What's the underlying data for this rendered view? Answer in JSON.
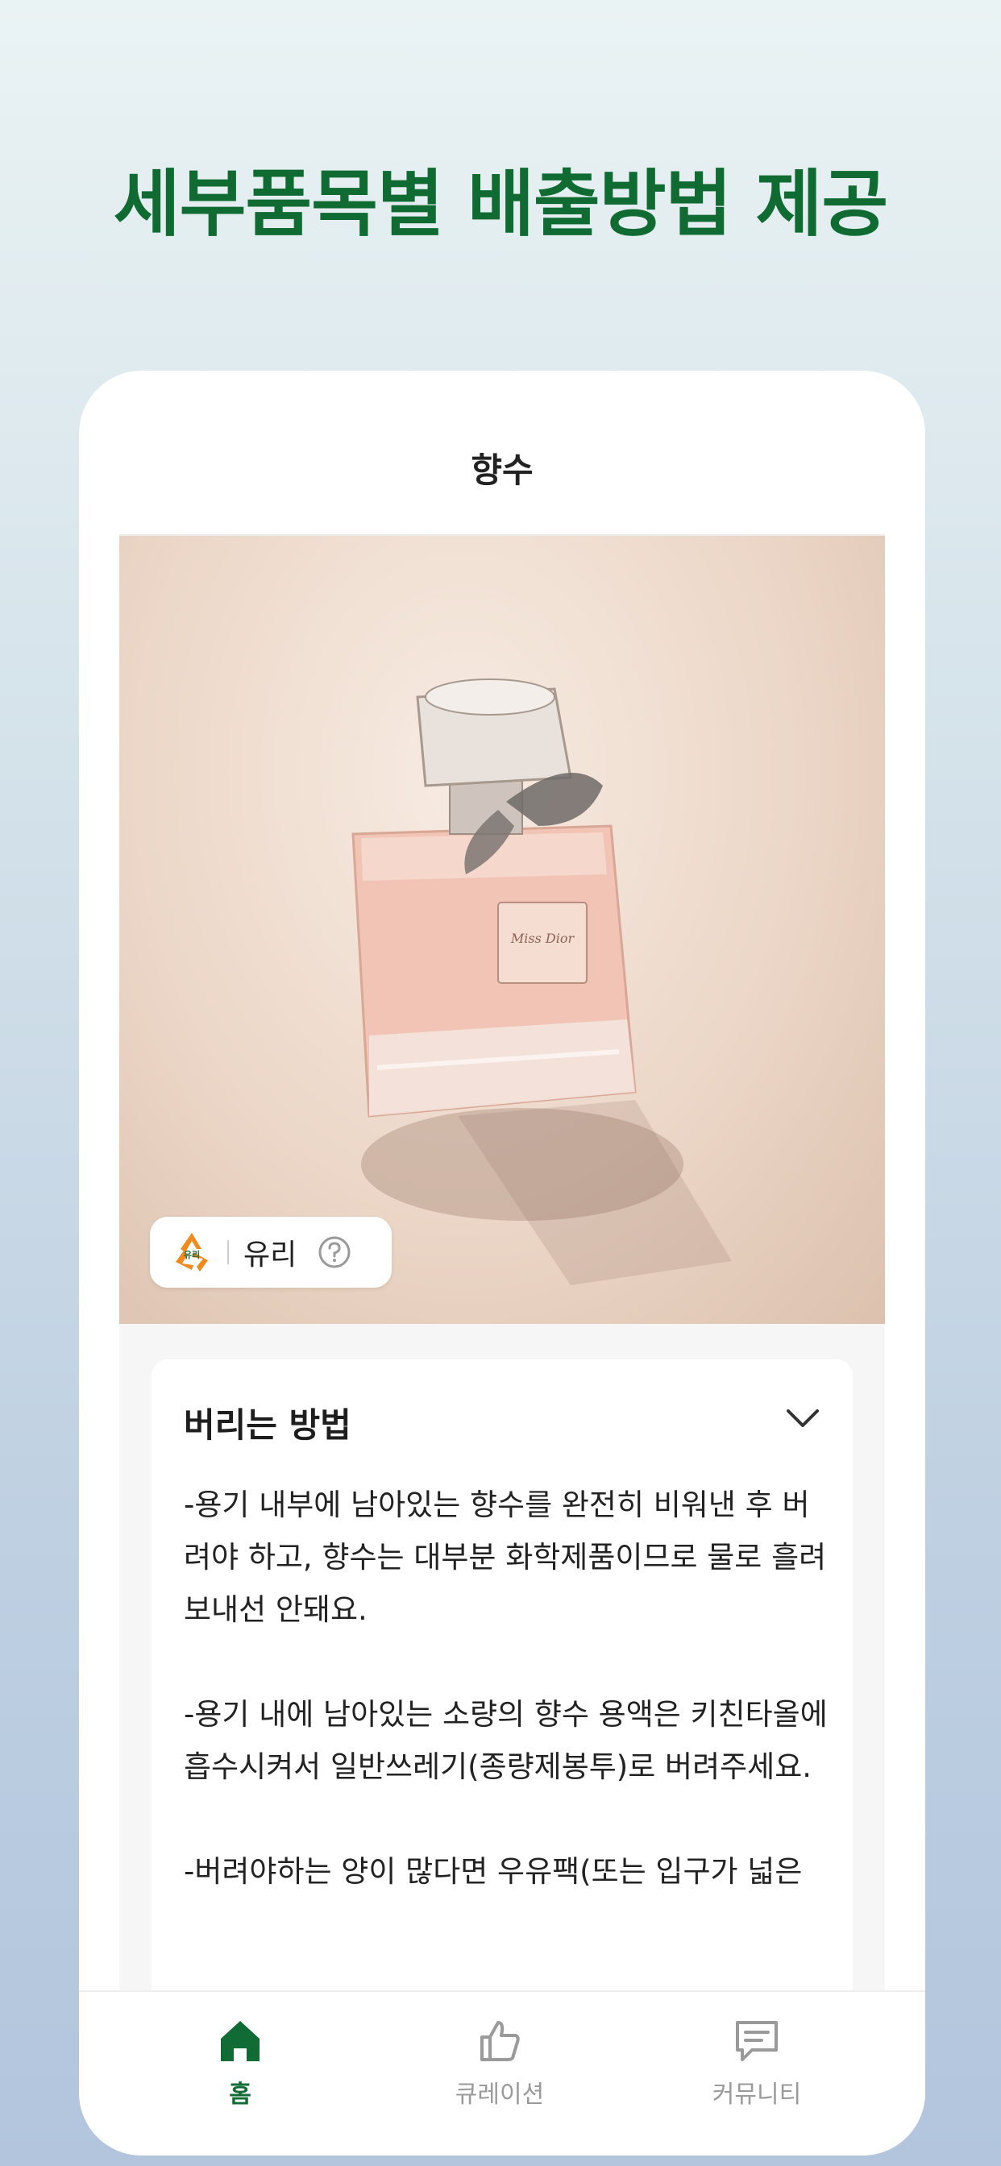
{
  "headline": "세부품목별 배출방법 제공",
  "screen": {
    "title": "향수"
  },
  "product_image": {
    "label_text": "Miss Dior"
  },
  "material_badge": {
    "icon_text": "유리",
    "label": "유리"
  },
  "disposal": {
    "title": "버리는 방법",
    "paragraphs": [
      "-용기 내부에 남아있는 향수를 완전히 비워낸 후 버려야 하고, 향수는 대부분 화학제품이므로 물로 흘려보내선 안돼요.",
      "-용기 내에 남아있는 소량의 향수 용액은 키친타올에 흡수시켜서 일반쓰레기(종량제봉투)로 버려주세요.",
      "-버려야하는 양이 많다면 우유팩(또는 입구가 넓은"
    ]
  },
  "nav": {
    "items": [
      {
        "label": "홈",
        "icon": "home-icon",
        "active": true
      },
      {
        "label": "큐레이션",
        "icon": "thumbs-up-icon",
        "active": false
      },
      {
        "label": "커뮤니티",
        "icon": "message-icon",
        "active": false
      }
    ]
  },
  "colors": {
    "brand_green": "#0f6b32",
    "inactive_gray": "#9a9a9a",
    "recycle_orange": "#f08a1c"
  }
}
